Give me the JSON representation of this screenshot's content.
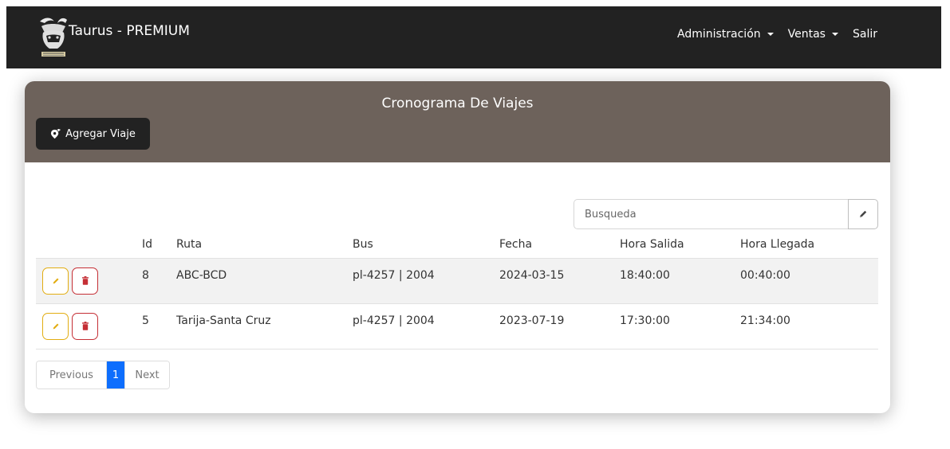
{
  "navbar": {
    "brand_title": "Taurus - PREMIUM",
    "menu": [
      {
        "label": "Administración",
        "has_dropdown": true
      },
      {
        "label": "Ventas",
        "has_dropdown": true
      },
      {
        "label": "Salir",
        "has_dropdown": false
      }
    ]
  },
  "header": {
    "title": "Cronograma De Viajes",
    "add_button_label": "Agregar Viaje",
    "add_button_icon": "map-marker-plus-icon"
  },
  "search": {
    "placeholder": "Busqueda",
    "button_icon": "pencil-icon"
  },
  "table": {
    "columns": [
      "",
      "Id",
      "Ruta",
      "Bus",
      "Fecha",
      "Hora Salida",
      "Hora Llegada"
    ],
    "rows": [
      {
        "id": "8",
        "ruta": "ABC-BCD",
        "bus": "pl-4257 | 2004",
        "fecha": "2024-03-15",
        "hora_salida": "18:40:00",
        "hora_llegada": "00:40:00"
      },
      {
        "id": "5",
        "ruta": "Tarija-Santa Cruz",
        "bus": "pl-4257 | 2004",
        "fecha": "2023-07-19",
        "hora_salida": "17:30:00",
        "hora_llegada": "21:34:00"
      }
    ]
  },
  "pagination": {
    "previous_label": "Previous",
    "current_page": "1",
    "next_label": "Next"
  },
  "colors": {
    "navbar_bg": "#222222",
    "card_header_bg": "#6d625b",
    "edit_accent": "#e2ad12",
    "delete_accent": "#c52f35",
    "page_active": "#0d6efd"
  }
}
